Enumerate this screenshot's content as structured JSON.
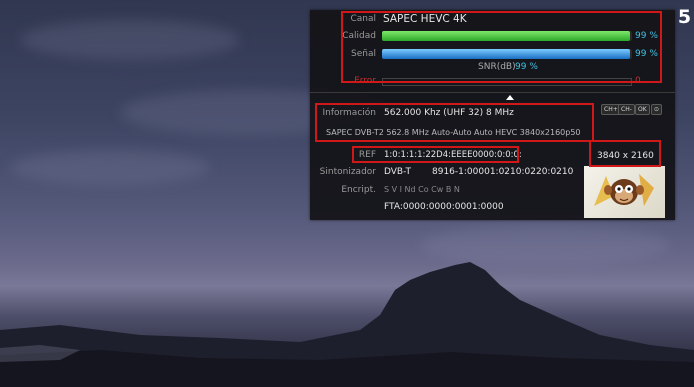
{
  "page_number": "5",
  "osd": {
    "canal_label": "Canal",
    "canal_value": "SAPEC HEVC 4K",
    "calidad_label": "Calidad",
    "calidad_pct": "99 %",
    "calidad_level": 0.99,
    "senal_label": "Señal",
    "senal_pct": "99 %",
    "senal_level": 0.99,
    "snr_label": "SNR(dB)",
    "snr_value": "99 %",
    "error_label": "Error",
    "error_value": "0",
    "keys": [
      "CH+",
      "CH-",
      "OK",
      "⊙"
    ],
    "info_label": "Información",
    "info_freq": "562.000 Khz (UHF 32) 8 MHz",
    "info_detail": "SAPEC DVB-T2 562.8 MHz Auto-Auto Auto HEVC 3840x2160p50",
    "ref_label": "REF",
    "ref_value": "1:0:1:1:1:22D4:EEEE0000:0:0:0:",
    "resolution": "3840 x 2160",
    "tuner_label": "Sintonizador",
    "tuner_type": "DVB-T",
    "tuner_pids": "8916-1:00001:0210:0220:0210",
    "encript_label": "Encript.",
    "encript_value": "S V I Nd Co Cw B N",
    "fta_value": "FTA:0000:0000:0001:0000"
  },
  "colors": {
    "calidad_bar": "#3fc43a",
    "senal_bar": "#2a8fe0",
    "highlight": "#d01818",
    "pct_text": "#40c0e0"
  }
}
